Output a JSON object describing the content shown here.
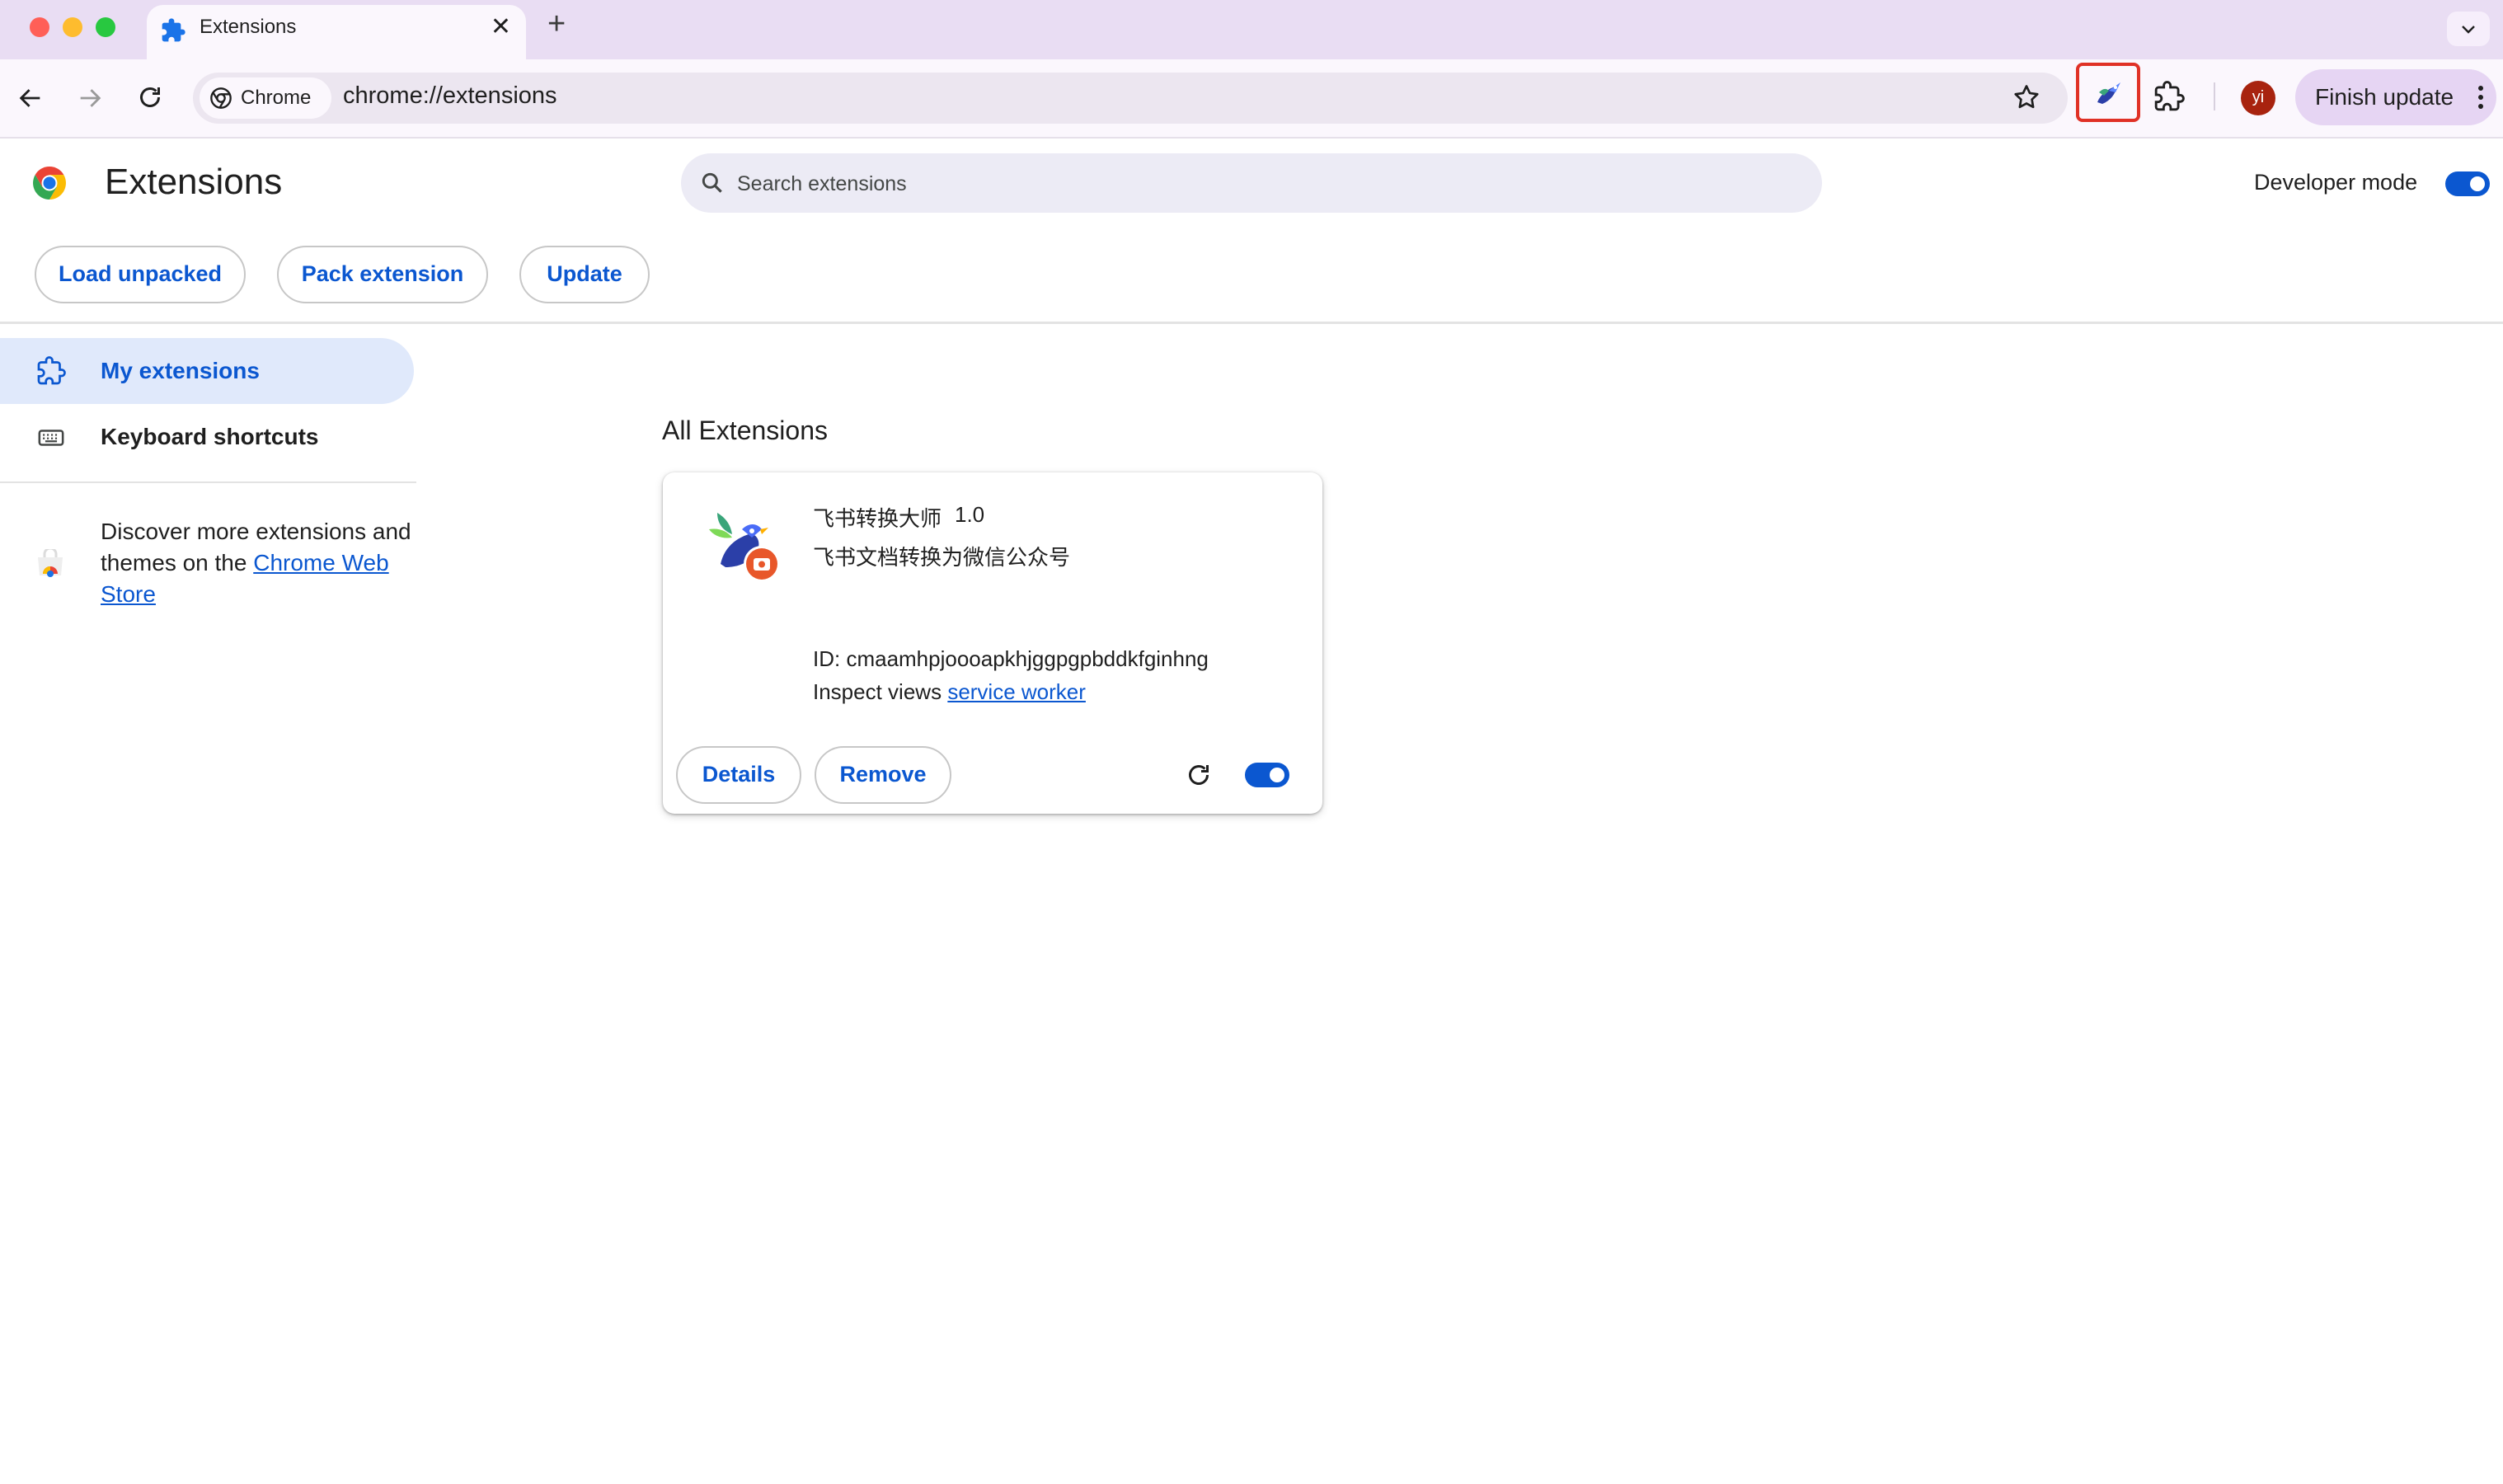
{
  "browser": {
    "tab": {
      "title": "Extensions",
      "close_glyph": "✕"
    },
    "new_tab_glyph": "+",
    "omnibox": {
      "chip_label": "Chrome",
      "url": "chrome://extensions"
    },
    "profile_initial": "yi",
    "finish_update_label": "Finish update",
    "highlight_color": "#e03126"
  },
  "page": {
    "title": "Extensions",
    "search_placeholder": "Search extensions",
    "developer_mode": {
      "label": "Developer mode",
      "enabled": true
    },
    "actions": {
      "load_unpacked": "Load unpacked",
      "pack_extension": "Pack extension",
      "update": "Update"
    }
  },
  "sidebar": {
    "items": [
      {
        "label": "My extensions",
        "selected": true,
        "icon": "extension-icon"
      },
      {
        "label": "Keyboard shortcuts",
        "selected": false,
        "icon": "keyboard-icon"
      }
    ],
    "discover": {
      "prefix": "Discover more extensions and themes on the ",
      "link": "Chrome Web Store"
    }
  },
  "main": {
    "section_title": "All Extensions",
    "extension": {
      "name": "飞书转换大师",
      "version": "1.0",
      "description": "飞书文档转换为微信公众号",
      "id_line": "ID: cmaamhpjoooapkhjggpgpbddkfginhng",
      "inspect_label": "Inspect views",
      "inspect_link": "service worker",
      "details_label": "Details",
      "remove_label": "Remove",
      "enabled": true
    }
  },
  "colors": {
    "accent": "#0b57d0",
    "titlebar": "#e9ddf3",
    "toolbar": "#fbf7fd"
  }
}
